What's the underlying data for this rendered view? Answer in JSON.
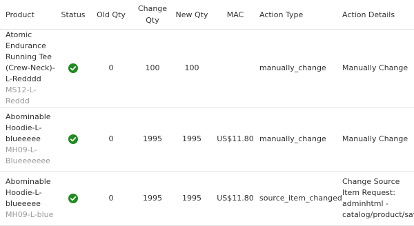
{
  "colors": {
    "status_ok": "#1f8a1f",
    "sku_text": "#9a9a9a",
    "divider": "#e3e3e3"
  },
  "headers": {
    "product": "Product",
    "status": "Status",
    "old_qty": "Old Qty",
    "change_qty": "Change Qty",
    "new_qty": "New Qty",
    "mac": "MAC",
    "action_type": "Action Type",
    "action_details": "Action Details"
  },
  "rows": [
    {
      "product_name": "Atomic Endurance Running Tee (Crew-Neck)-L-Redddd",
      "sku": "MS12-L-Reddd",
      "status_icon": "check-circle-icon",
      "old_qty": "0",
      "change_qty": "100",
      "new_qty": "100",
      "mac": "",
      "action_type": "manually_change",
      "action_details": "Manually Change"
    },
    {
      "product_name": "Abominable Hoodie-L-blueeeee",
      "sku": "MH09-L-Blueeeeeee",
      "status_icon": "check-circle-icon",
      "old_qty": "0",
      "change_qty": "1995",
      "new_qty": "1995",
      "mac": "US$11.80",
      "action_type": "manually_change",
      "action_details": "Manually Change"
    },
    {
      "product_name": "Abominable Hoodie-L-blueeeee",
      "sku": "MH09-L-blue",
      "status_icon": "check-circle-icon",
      "old_qty": "0",
      "change_qty": "1995",
      "new_qty": "1995",
      "mac": "US$11.80",
      "action_type": "source_item_changed",
      "action_details": "Change Source Item Request: adminhtml - catalog/product/save"
    }
  ]
}
